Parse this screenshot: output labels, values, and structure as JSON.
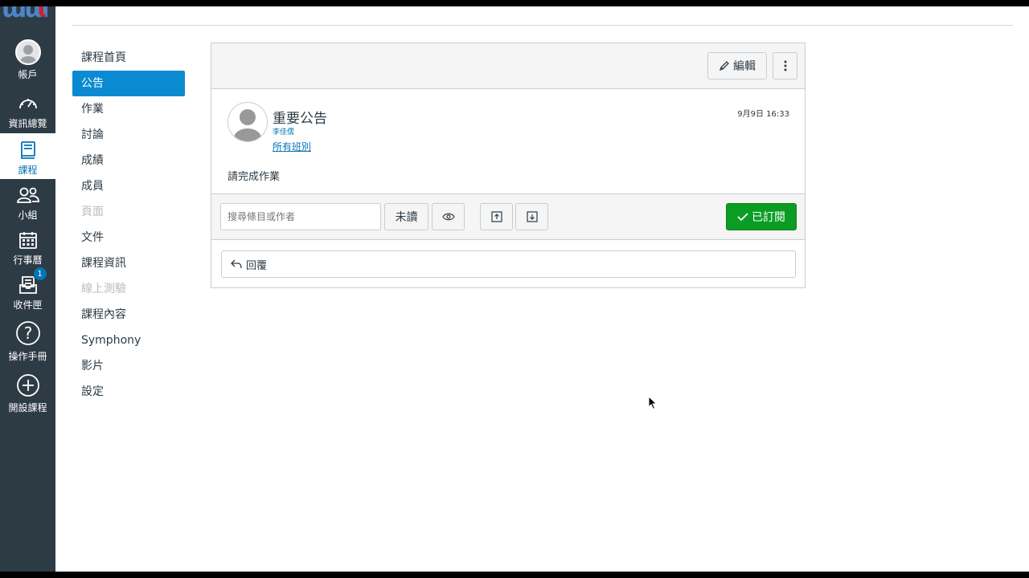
{
  "global_nav": {
    "items": [
      {
        "label": "帳戶",
        "icon": "account-avatar-icon"
      },
      {
        "label": "資訊總覽",
        "icon": "dashboard-gauge-icon"
      },
      {
        "label": "課程",
        "icon": "courses-book-icon"
      },
      {
        "label": "小組",
        "icon": "groups-people-icon"
      },
      {
        "label": "行事曆",
        "icon": "calendar-icon"
      },
      {
        "label": "收件匣",
        "icon": "inbox-icon",
        "badge": "1"
      },
      {
        "label": "操作手冊",
        "icon": "help-question-icon"
      },
      {
        "label": "開設課程",
        "icon": "add-course-plus-icon"
      }
    ]
  },
  "course_nav": {
    "items": [
      {
        "label": "課程首頁",
        "state": "normal"
      },
      {
        "label": "公告",
        "state": "active"
      },
      {
        "label": "作業",
        "state": "normal"
      },
      {
        "label": "討論",
        "state": "normal"
      },
      {
        "label": "成績",
        "state": "normal"
      },
      {
        "label": "成員",
        "state": "normal"
      },
      {
        "label": "頁面",
        "state": "disabled"
      },
      {
        "label": "文件",
        "state": "normal"
      },
      {
        "label": "課程資訊",
        "state": "normal"
      },
      {
        "label": "線上測驗",
        "state": "disabled"
      },
      {
        "label": "課程內容",
        "state": "normal"
      },
      {
        "label": "Symphony",
        "state": "normal"
      },
      {
        "label": "影片",
        "state": "normal"
      },
      {
        "label": "設定",
        "state": "normal"
      }
    ]
  },
  "toolbar": {
    "edit_label": "編輯"
  },
  "announcement": {
    "title": "重要公告",
    "author": "李佳儒",
    "sections": "所有班別",
    "date": "9月9日 16:33",
    "body": "請完成作業"
  },
  "filter_bar": {
    "search_placeholder": "搜尋條目或作者",
    "unread_label": "未讀",
    "subscribed_label": "已訂閱"
  },
  "reply": {
    "label": "回覆"
  },
  "colors": {
    "nav_bg": "#2d3b45",
    "active_blue": "#0a8bd1",
    "link_blue": "#0374b5",
    "subscribe_green": "#0b9d23"
  }
}
